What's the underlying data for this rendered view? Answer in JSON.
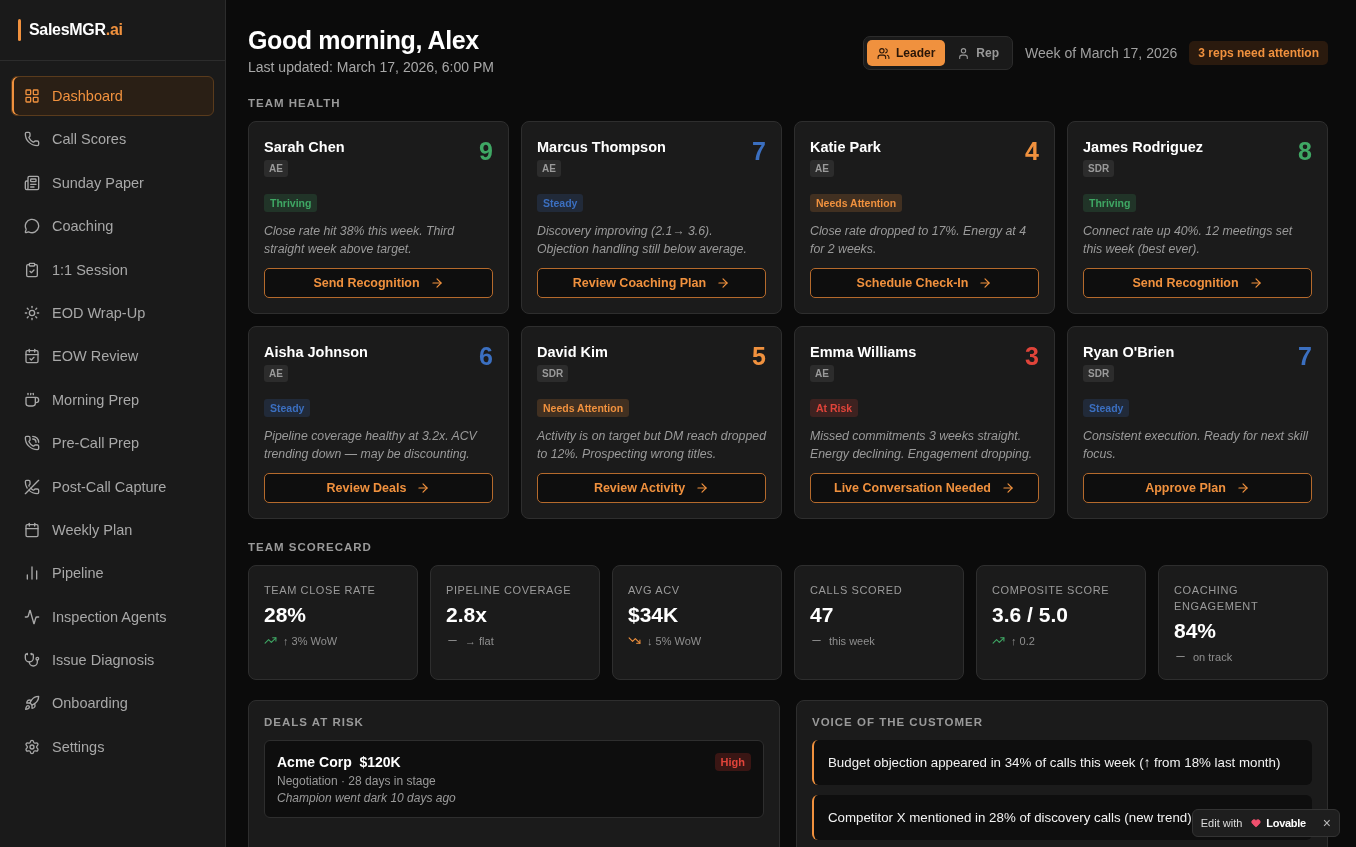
{
  "sidebar": {
    "logo": {
      "name": "SalesMGR",
      "suffix": ".ai"
    },
    "items": [
      {
        "label": "Dashboard",
        "selected": true
      },
      {
        "label": "Call Scores",
        "selected": false
      },
      {
        "label": "Sunday Paper",
        "selected": false
      },
      {
        "label": "Coaching",
        "selected": false
      },
      {
        "label": "1:1 Session",
        "selected": false
      },
      {
        "label": "EOD Wrap-Up",
        "selected": false
      },
      {
        "label": "EOW Review",
        "selected": false
      },
      {
        "label": "Morning Prep",
        "selected": false
      },
      {
        "label": "Pre-Call Prep",
        "selected": false
      },
      {
        "label": "Post-Call Capture",
        "selected": false
      },
      {
        "label": "Weekly Plan",
        "selected": false
      },
      {
        "label": "Pipeline",
        "selected": false
      },
      {
        "label": "Inspection Agents",
        "selected": false
      },
      {
        "label": "Issue Diagnosis",
        "selected": false
      },
      {
        "label": "Onboarding",
        "selected": false
      },
      {
        "label": "Settings",
        "selected": false
      }
    ]
  },
  "header": {
    "greeting": "Good morning, Alex",
    "updated": "Last updated: March 17, 2026, 6:00 PM",
    "roles": [
      {
        "label": "Leader",
        "selected": true
      },
      {
        "label": "Rep",
        "selected": false
      }
    ],
    "week": "Week of March 17, 2026",
    "alert": "3 reps need attention"
  },
  "team_health": {
    "title": "TEAM HEALTH",
    "reps": [
      {
        "name": "Sarah Chen",
        "role": "AE",
        "score": "9",
        "color": "#3fa764",
        "status": "Thriving",
        "note": "Close rate hit 38% this week. Third straight week above target.",
        "action": "Send Recognition"
      },
      {
        "name": "Marcus Thompson",
        "role": "AE",
        "score": "7",
        "color": "#3b6fc0",
        "status": "Steady",
        "note": "Discovery improving (2.1→ 3.6). Objection handling still below average.",
        "action": "Review Coaching Plan"
      },
      {
        "name": "Katie Park",
        "role": "AE",
        "score": "4",
        "color": "#f0913e",
        "status": "Needs Attention",
        "note": "Close rate dropped to 17%. Energy at 4 for 2 weeks.",
        "action": "Schedule Check-In"
      },
      {
        "name": "James Rodriguez",
        "role": "SDR",
        "score": "8",
        "color": "#3fa764",
        "status": "Thriving",
        "note": "Connect rate up 40%. 12 meetings set this week (best ever).",
        "action": "Send Recognition"
      },
      {
        "name": "Aisha Johnson",
        "role": "AE",
        "score": "6",
        "color": "#3b6fc0",
        "status": "Steady",
        "note": "Pipeline coverage healthy at 3.2x. ACV trending down — may be discounting.",
        "action": "Review Deals"
      },
      {
        "name": "David Kim",
        "role": "SDR",
        "score": "5",
        "color": "#f0913e",
        "status": "Needs Attention",
        "note": "Activity is on target but DM reach dropped to 12%. Prospecting wrong titles.",
        "action": "Review Activity"
      },
      {
        "name": "Emma Williams",
        "role": "AE",
        "score": "3",
        "color": "#e0443a",
        "status": "At Risk",
        "note": "Missed commitments 3 weeks straight. Energy declining. Engagement dropping.",
        "action": "Live Conversation Needed"
      },
      {
        "name": "Ryan O'Brien",
        "role": "SDR",
        "score": "7",
        "color": "#3b6fc0",
        "status": "Steady",
        "note": "Consistent execution. Ready for next skill focus.",
        "action": "Approve Plan"
      }
    ]
  },
  "scorecard": {
    "title": "TEAM SCORECARD",
    "metrics": [
      {
        "label": "TEAM CLOSE RATE",
        "value": "28%",
        "kind": "up",
        "change": "↑ 3% WoW"
      },
      {
        "label": "PIPELINE COVERAGE",
        "value": "2.8x",
        "kind": "flat",
        "change": "→ flat"
      },
      {
        "label": "AVG ACV",
        "value": "$34K",
        "kind": "down",
        "change": "↓ 5% WoW"
      },
      {
        "label": "CALLS SCORED",
        "value": "47",
        "kind": "flat",
        "change": "this week"
      },
      {
        "label": "COMPOSITE SCORE",
        "value": "3.6 / 5.0",
        "kind": "up",
        "change": "↑ 0.2"
      },
      {
        "label": "COACHING ENGAGEMENT",
        "value": "84%",
        "kind": "flat",
        "change": "on track"
      }
    ]
  },
  "deals_at_risk": {
    "title": "DEALS AT RISK",
    "deals": [
      {
        "company": "Acme Corp",
        "amount": "$120K",
        "risk": "High",
        "stage": "Negotiation · 28 days in stage",
        "note": "Champion went dark 10 days ago"
      }
    ]
  },
  "voice_of_customer": {
    "title": "VOICE OF THE CUSTOMER",
    "insights": [
      "Budget objection appeared in 34% of calls this week (↑ from 18% last month)",
      "Competitor X mentioned in 28% of discovery calls (new trend)"
    ]
  },
  "edit_badge": {
    "prefix": "Edit with",
    "brand": "Lovable",
    "close": "×"
  }
}
